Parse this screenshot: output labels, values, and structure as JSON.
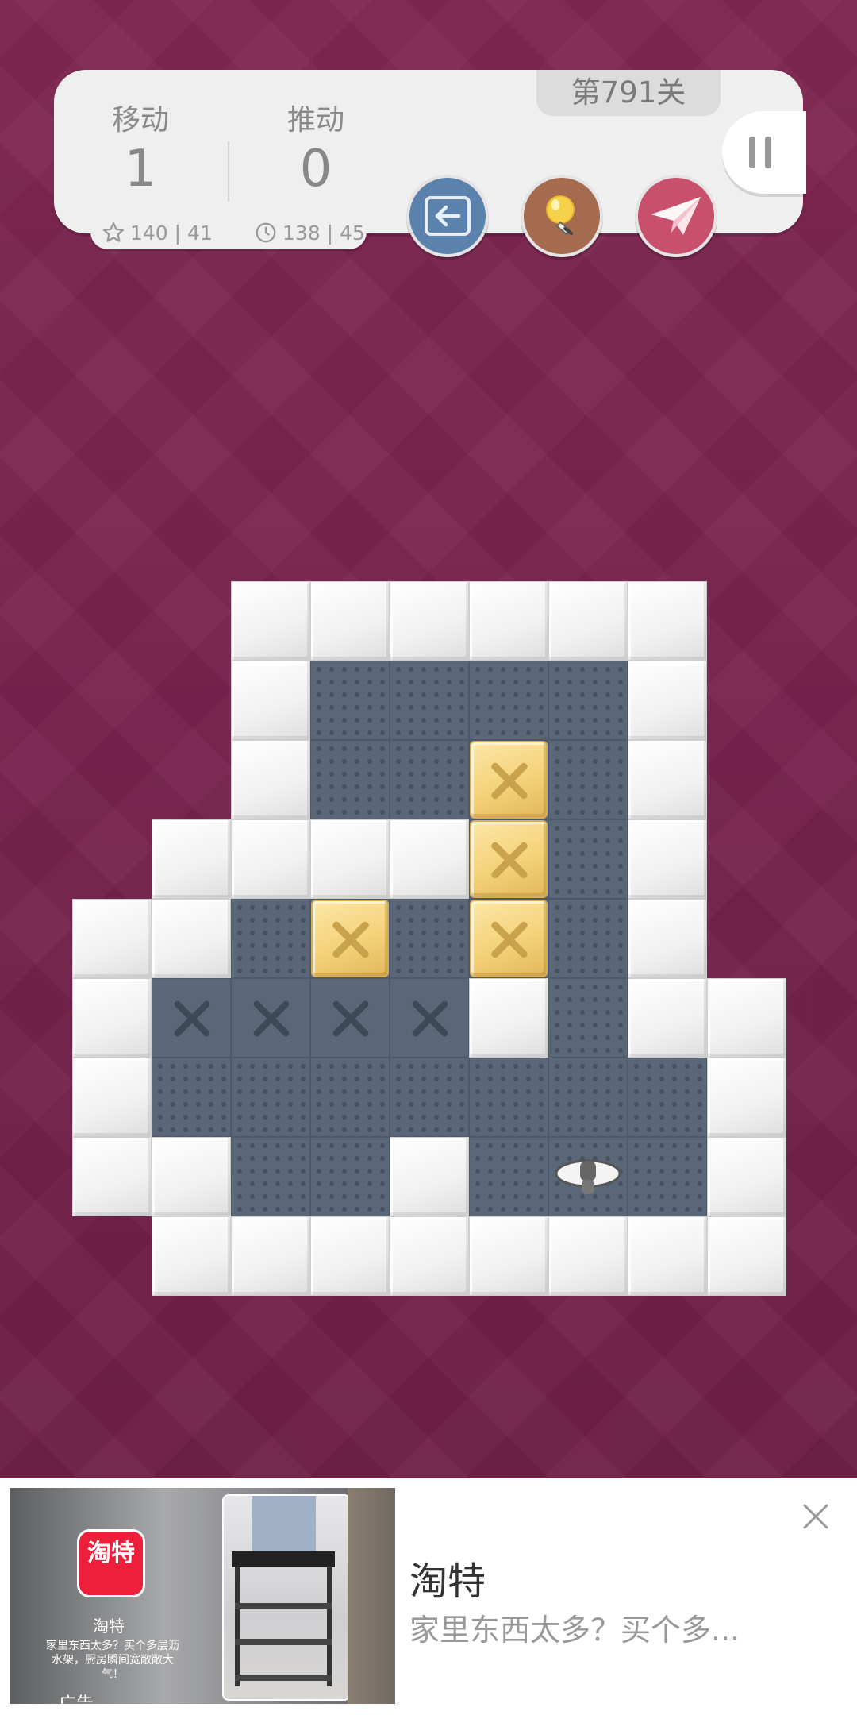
{
  "hud": {
    "moves_label": "移动",
    "moves_value": "1",
    "pushes_label": "推动",
    "pushes_value": "0",
    "best_moves": "140 | 41",
    "best_time": "138 | 45",
    "level": "第791关"
  },
  "buttons": {
    "undo_icon": "undo-arrow-icon",
    "hint_icon": "lightbulb-icon",
    "share_icon": "paper-plane-icon",
    "pause_icon": "pause-icon"
  },
  "colors": {
    "background": "#7a2550",
    "undo_button": "#5b82ad",
    "hint_button": "#a56b4e",
    "share_button": "#c9506c",
    "floor": "#5a6779",
    "box": "#f4d27a"
  },
  "board": {
    "columns": 9,
    "rows": 9,
    "legend": "W=wall, F=floor, T=target, B=box, P=player, _=empty",
    "grid": [
      "__WWWWWW_",
      "__WFFFFW_",
      "__WFFBFW_",
      "_WWWWBFW_",
      "WWFBFBFW_",
      "WTTTTWFWW",
      "WFFFFFFFW",
      "WWFFWFPFW",
      "_WWWWWWWW"
    ]
  },
  "ad": {
    "media_logo": "淘特",
    "media_name": "淘特",
    "media_desc": "家里东西太多？买个多层沥水架，厨房瞬间宽敞敞大气！",
    "media_tag": "广告",
    "title": "淘特",
    "description": "家里东西太多？买个多..."
  }
}
